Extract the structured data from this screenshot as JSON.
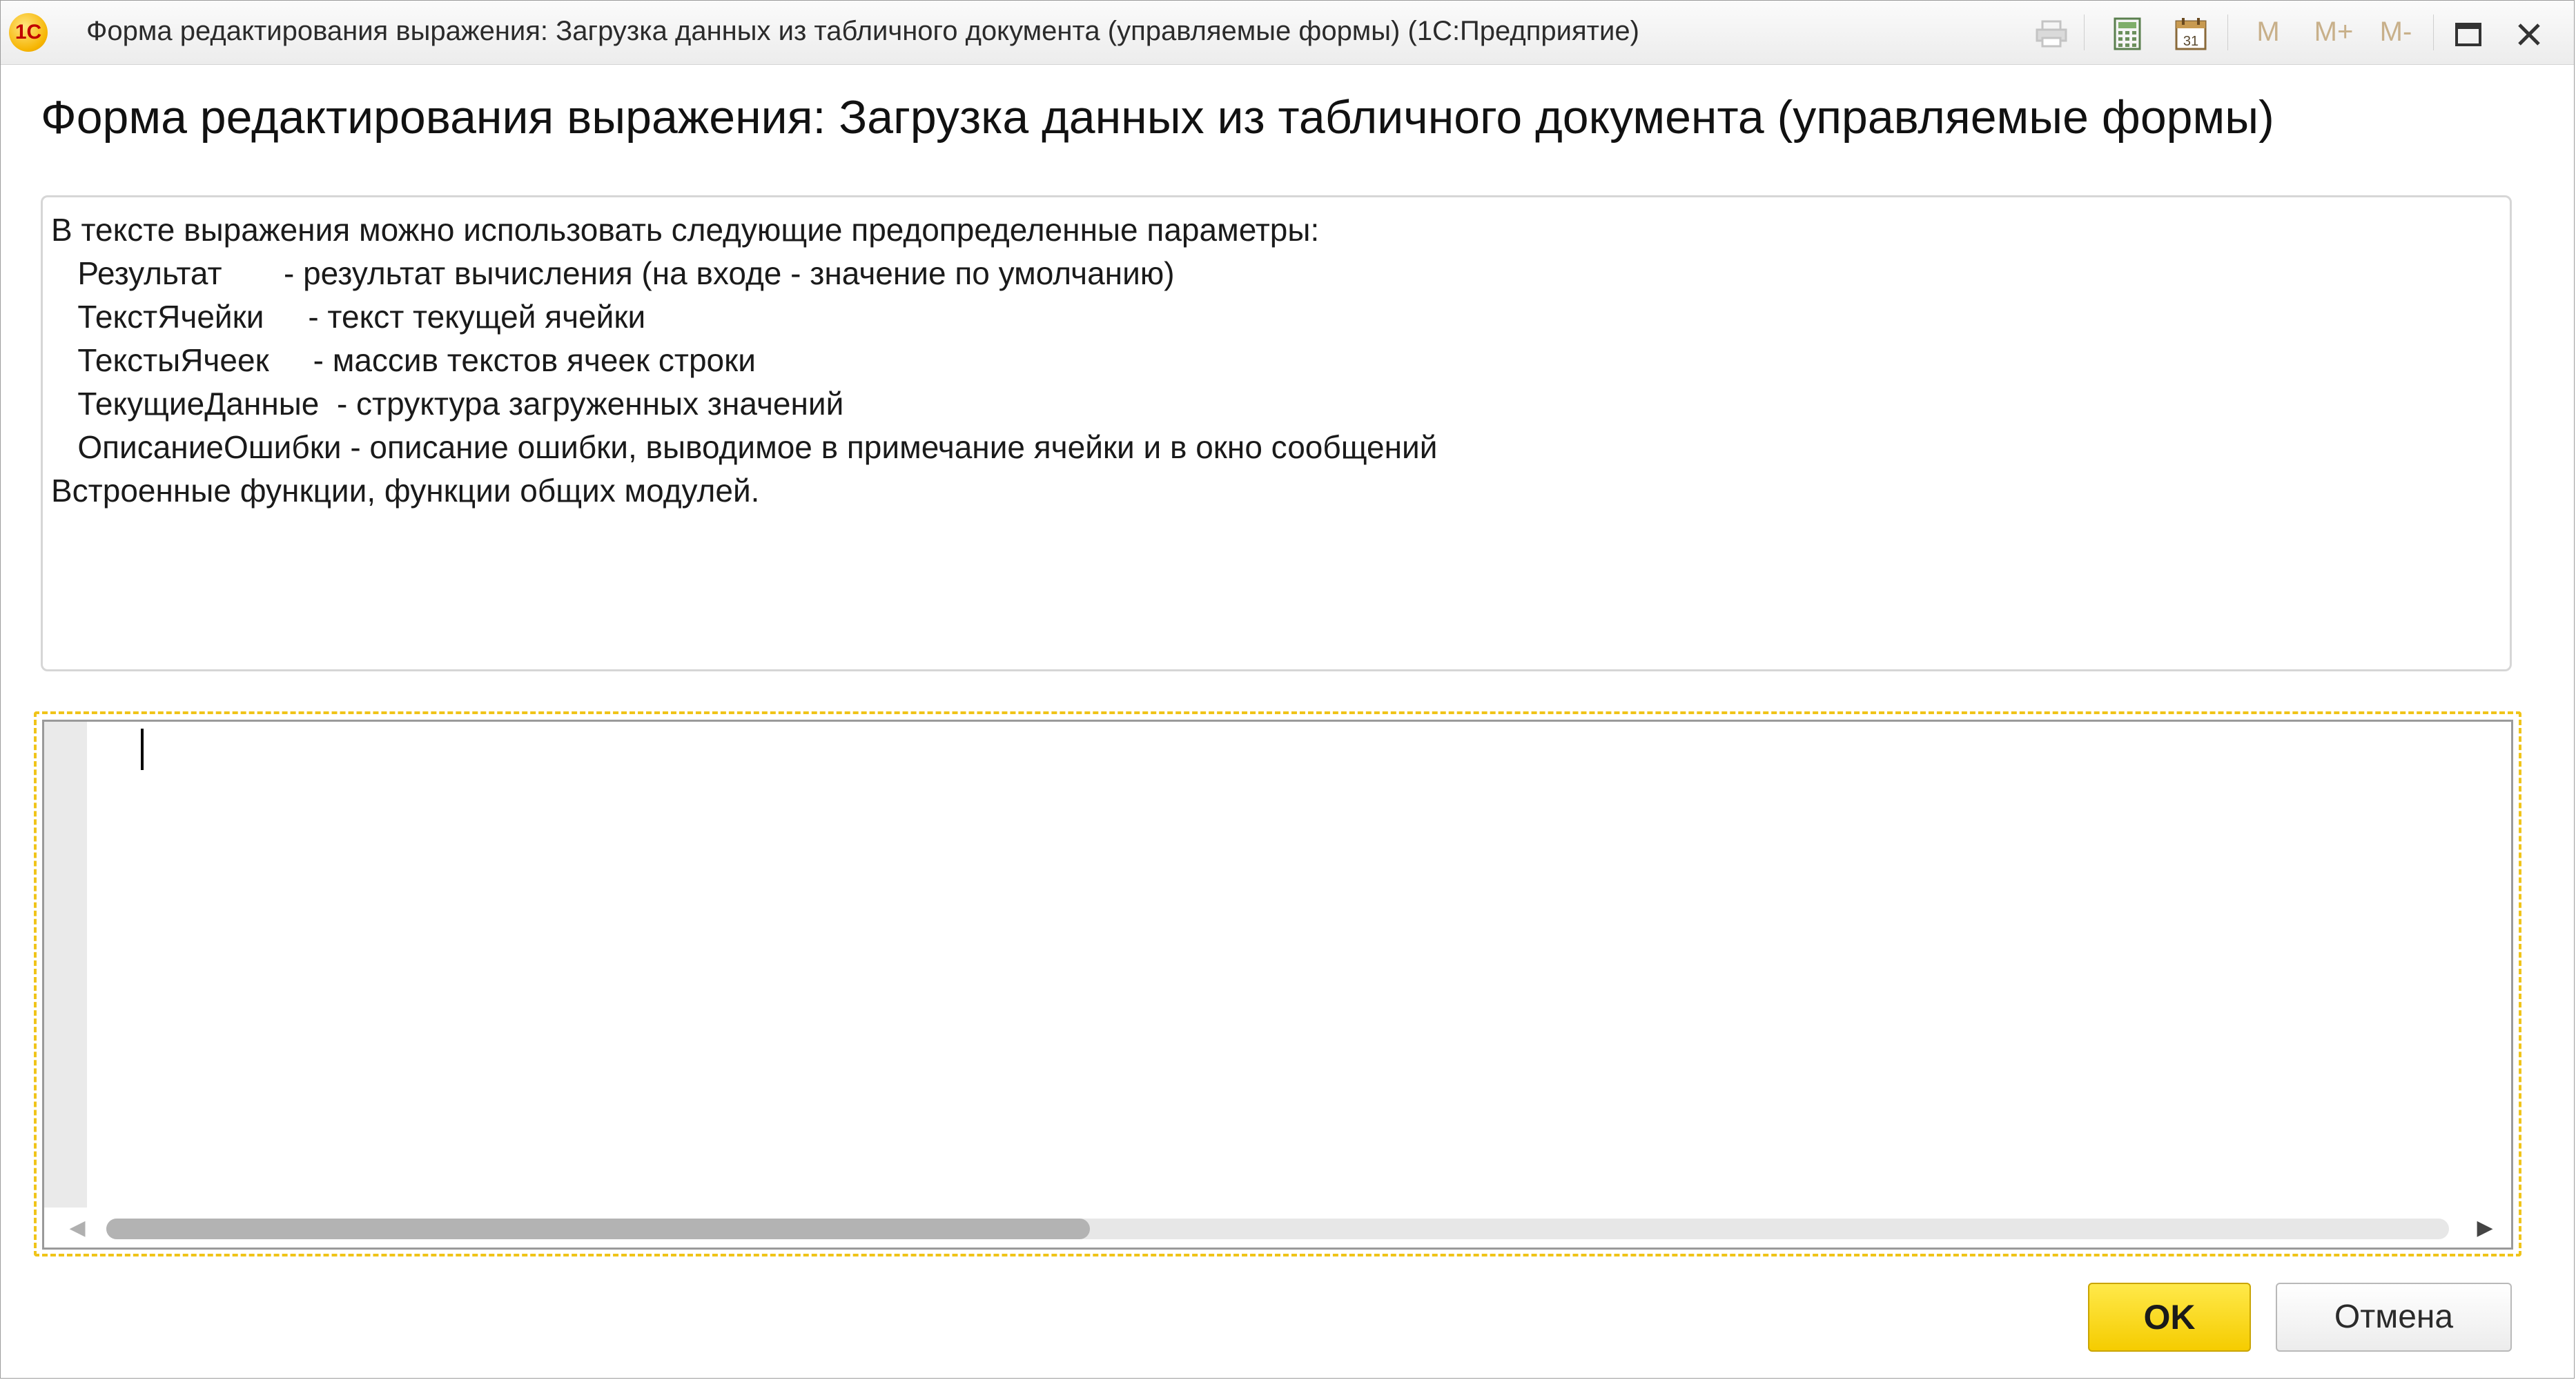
{
  "window": {
    "title": "Форма редактирования выражения: Загрузка данных из табличного документа (управляемые формы)  (1С:Предприятие)",
    "logo_text": "1С",
    "memory_buttons": [
      "M",
      "M+",
      "M-"
    ],
    "calendar_day": "31"
  },
  "form": {
    "title": "Форма редактирования выражения: Загрузка данных из табличного документа (управляемые формы)"
  },
  "help": {
    "lines": [
      "В тексте выражения можно использовать следующие предопределенные параметры:",
      "   Результат       - результат вычисления (на входе - значение по умолчанию)",
      "   ТекстЯчейки     - текст текущей ячейки",
      "   ТекстыЯчеек     - массив текстов ячеек строки",
      "   ТекущиеДанные  - структура загруженных значений",
      "   ОписаниеОшибки - описание ошибки, выводимое в примечание ячейки и в окно сообщений",
      "Встроенные функции, функции общих модулей."
    ]
  },
  "editor": {
    "value": "",
    "scroll_position": 0.42
  },
  "buttons": {
    "ok": "OK",
    "cancel": "Отмена"
  },
  "colors": {
    "ok_button": "#f5cc00",
    "focus_frame": "#f0c419",
    "logo": "#f6b400"
  }
}
